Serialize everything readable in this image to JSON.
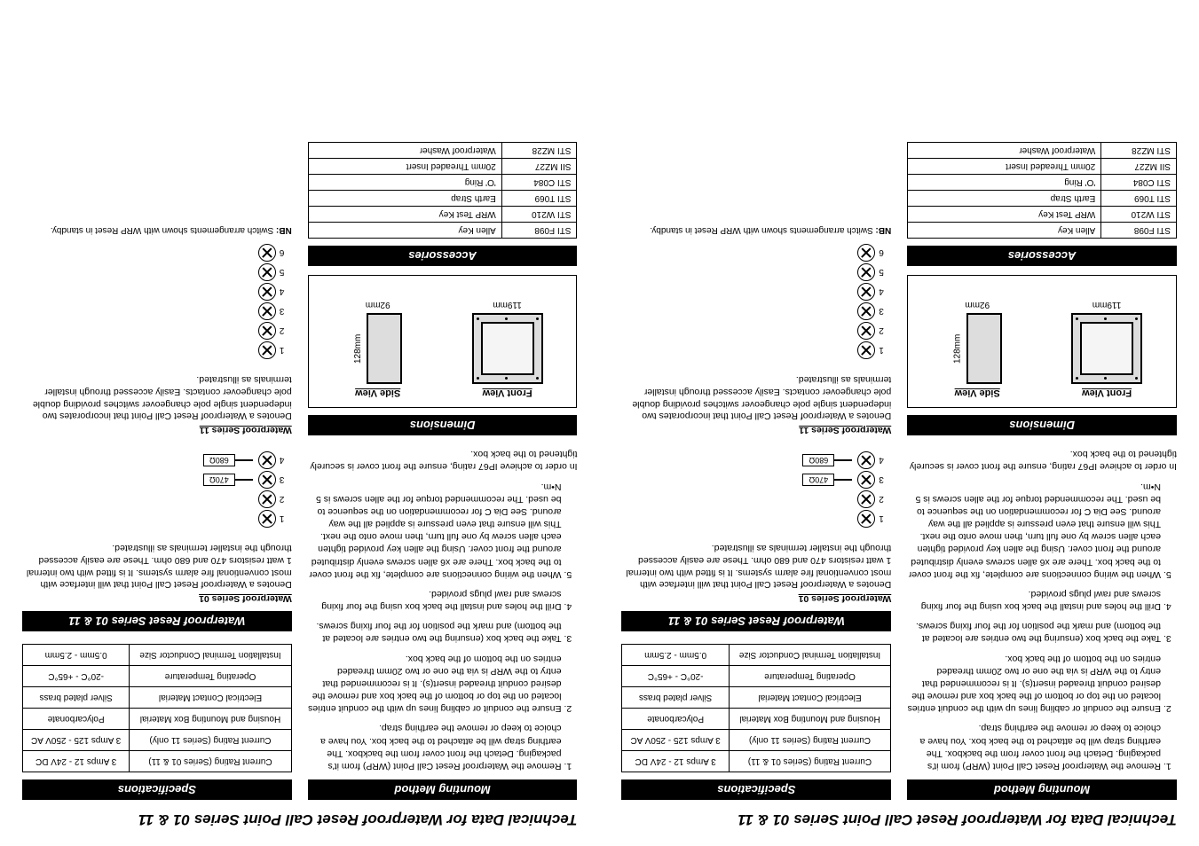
{
  "title": "Technical Data for Waterproof Reset Call Point Series 01 & 11",
  "mounting": {
    "header": "Mounting Method",
    "steps": [
      "Remove the Waterproof Reset Call Point (WRP) from it's packaging.  Detach the front cover from the backbox. The earthing strap will be attached to the back box.  You have a choice to keep or remove the earthing strap.",
      "Ensure the conduit or cabling lines up with the conduit entries located on the top or bottom of the back box and remove the desired conduit threaded insert(s).  It is recommended that entry to the WRP is via the one or two 20mm threaded entries on the bottom of the back box.",
      "Take the back box (ensuring the two entries are located at the bottom) and mark the position for the four fixing screws.",
      "Drill the holes and install the back box using the four fixing screws and rawl plugs provided.",
      "When the wiring connections are complete, fix the front cover to the back box. There are x6 allen screws evenly distributed around the front cover.  Using the  allen key provided tighten each allen screw by one full turn, then move onto the next. This will ensure that even pressure is applied all the way around.  See Dia C for recommendation on the sequence to be used.  The recommended torque for the allen screws is 5 N•m."
    ],
    "footer": "In order to achieve IP67 rating, ensure the front cover is securely tightened to the back box."
  },
  "specs": {
    "header": "Specifications",
    "rows": [
      [
        "Current Rating (Series 01 & 11)",
        "3 Amps 12 - 24V DC"
      ],
      [
        "Current Rating (Series 11 only)",
        "3 Amps 125 - 250V AC"
      ],
      [
        "Housing and Mounting Box Material",
        "Polycarbonate"
      ],
      [
        "Electrical Contact Material",
        "Silver plated brass"
      ],
      [
        "Operating Temperature",
        "-20°C - +65°C"
      ],
      [
        "Installation Terminal Conductor Size",
        "0.5mm - 2.5mm"
      ]
    ]
  },
  "wrs": {
    "header": "Waterproof Reset Series 01 & 11",
    "s01": {
      "title": "Waterproof Series 01",
      "text": "Denotes a Waterproof Reset Call Point that will interface with most conventional fire alarm systems. It is fitted with two internal 1 watt resistors 470 and 680 ohm. These are easily accessed through the installer terminals as illustrated."
    },
    "s11": {
      "title": "Waterproof Series 11",
      "text": "Denotes a Waterproof Reset Call Point that incorporates two independent single pole changeover switches providing double pole changeover contacts.  Easily accessed through installer terminals as illustrated."
    },
    "res": [
      "470Ω",
      "680Ω"
    ]
  },
  "dims": {
    "header": "Dimensions",
    "front": "Front View",
    "side": "Side View",
    "w": "119mm",
    "h": "92mm",
    "d": "128mm"
  },
  "acc": {
    "header": "Accessories",
    "rows": [
      [
        "STI F098",
        "Allen Key"
      ],
      [
        "STI W210",
        "WRP Test Key"
      ],
      [
        "STI T069",
        "Earth Strap"
      ],
      [
        "STI C084",
        "'O' Ring"
      ],
      [
        "SII MZ27",
        "20mm Threaded Insert"
      ],
      [
        "STI MZ28",
        "Waterproof Washer"
      ]
    ]
  },
  "nb": {
    "label": "NB:",
    "text": " Switch arrangements shown with WRP Reset in standby."
  }
}
